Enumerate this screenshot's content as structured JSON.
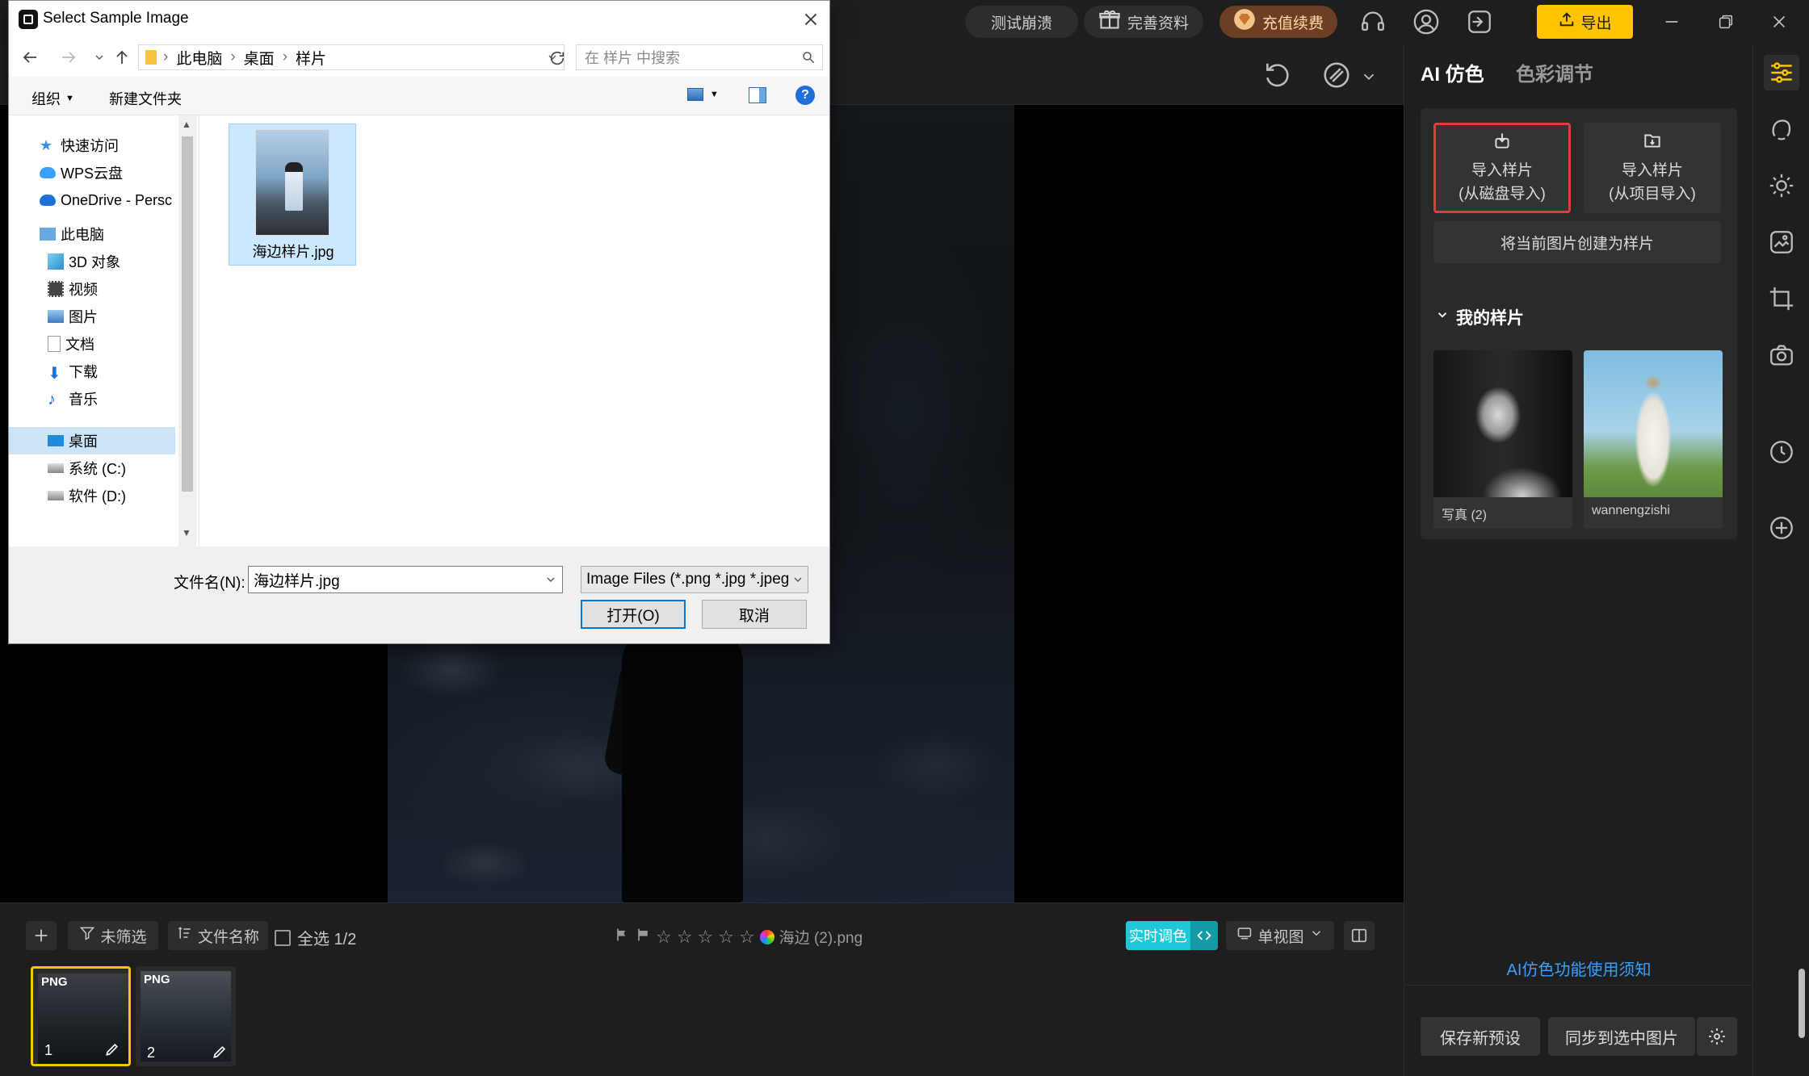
{
  "topbar": {
    "crash_test": "测试崩溃",
    "complete_profile": "完善资料",
    "recharge": "充值续费",
    "export": "导出"
  },
  "right_panel": {
    "tab_ai": "AI 仿色",
    "tab_color": "色彩调节",
    "import_disk_line1": "导入样片",
    "import_disk_line2": "(从磁盘导入)",
    "import_project_line1": "导入样片",
    "import_project_line2": "(从项目导入)",
    "create_from_current": "将当前图片创建为样片",
    "my_samples_title": "我的样片",
    "samples": [
      {
        "caption": "写真 (2)"
      },
      {
        "caption": "wannengzishi"
      }
    ],
    "ai_notice_link": "AI仿色功能使用须知",
    "save_preset": "保存新预设",
    "sync_selected": "同步到选中图片"
  },
  "bottom_bar": {
    "filter_label": "未筛选",
    "sort_label": "文件名称",
    "select_all": "全选 1/2",
    "current_file": "海边 (2).png",
    "realtime_toggle": "实时调色",
    "view_mode": "单视图",
    "thumbnails": [
      {
        "format": "PNG",
        "index": "1"
      },
      {
        "format": "PNG",
        "index": "2"
      }
    ]
  },
  "dialog": {
    "title": "Select Sample Image",
    "path": [
      "此电脑",
      "桌面",
      "样片"
    ],
    "search_placeholder": "在 样片 中搜索",
    "organize": "组织",
    "new_folder": "新建文件夹",
    "nav_items": [
      {
        "label": "快速访问"
      },
      {
        "label": "WPS云盘"
      },
      {
        "label": "OneDrive - Persc"
      },
      {
        "label": "此电脑"
      },
      {
        "label": "3D 对象"
      },
      {
        "label": "视频"
      },
      {
        "label": "图片"
      },
      {
        "label": "文档"
      },
      {
        "label": "下载"
      },
      {
        "label": "音乐"
      },
      {
        "label": "桌面"
      },
      {
        "label": "系统 (C:)"
      },
      {
        "label": "软件 (D:)"
      }
    ],
    "file_name": "海边样片.jpg",
    "filename_label": "文件名(N):",
    "filename_value": "海边样片.jpg",
    "filter_value": "Image Files (*.png *.jpg *.jpeg",
    "open_button": "打开(O)",
    "cancel_button": "取消"
  },
  "colors": {
    "accent_yellow": "#ffc400",
    "accent_cyan": "#1ec8d8",
    "highlight_red": "#e23b3b",
    "link_blue": "#3aa0ff"
  }
}
